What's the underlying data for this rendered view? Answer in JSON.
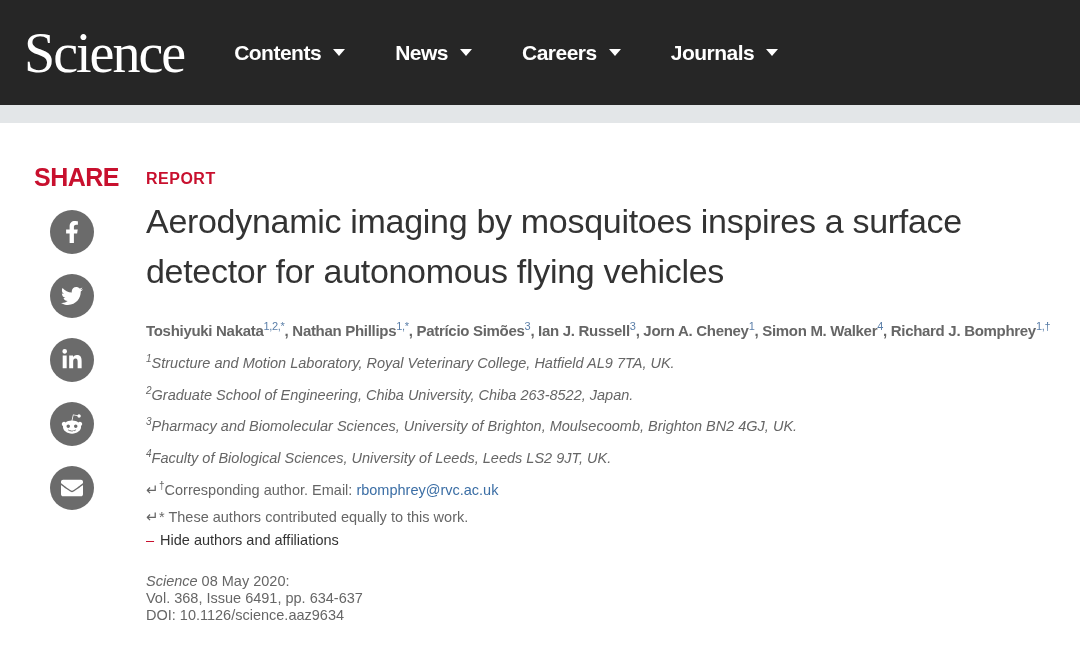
{
  "header": {
    "logo": "Science",
    "nav": [
      {
        "label": "Contents"
      },
      {
        "label": "News"
      },
      {
        "label": "Careers"
      },
      {
        "label": "Journals"
      }
    ]
  },
  "share": {
    "label": "SHARE",
    "buttons": [
      {
        "kind": "facebook"
      },
      {
        "kind": "twitter"
      },
      {
        "kind": "linkedin"
      },
      {
        "kind": "reddit"
      },
      {
        "kind": "email"
      }
    ]
  },
  "article": {
    "type": "REPORT",
    "title": "Aerodynamic imaging by mosquitoes inspires a surface detector for autonomous flying vehicles",
    "authors": "Toshiyuki Nakata$^{1,2,*}$, Nathan Phillips$^{1,*}$, Patrício Simões$^{3}$, Ian J. Russell$^{3}$, Jorn A. Cheney$^{1}$, Simon M. Walker$^{4}$, Richard J. Bomphrey$^{1,†}$",
    "affiliations": [
      "$^{1}$Structure and Motion Laboratory, Royal Veterinary College, Hatfield AL9 7TA, UK.",
      "$^{2}$Graduate School of Engineering, Chiba University, Chiba 263-8522, Japan.",
      "$^{3}$Pharmacy and Biomolecular Sciences, University of Brighton, Moulsecoomb, Brighton BN2 4GJ, UK.",
      "$^{4}$Faculty of Biological Sciences, University of Leeds, Leeds LS2 9JT, UK."
    ],
    "corresponding": {
      "text": "↵$^{†}$Corresponding author. Email: ",
      "email": "rbomphrey@rvc.ac.uk"
    },
    "equal": "↵* These authors contributed equally to this work.",
    "toggle": {
      "icon": "–",
      "label": "Hide authors and affiliations"
    },
    "citation": [
      "*Science*  08 May 2020:",
      "Vol. 368, Issue 6491, pp. 634-637",
      "DOI: 10.1126/science.aaz9634"
    ]
  }
}
